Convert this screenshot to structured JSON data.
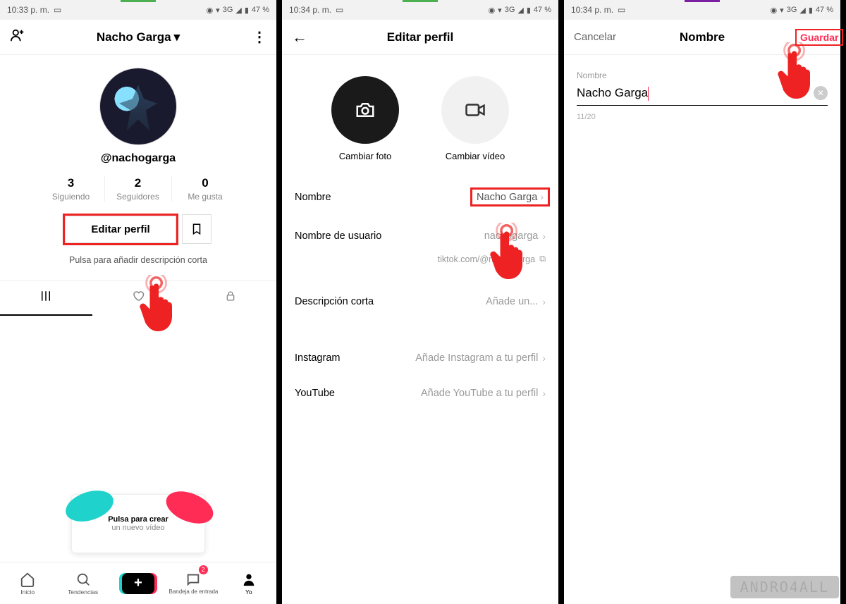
{
  "statusbar": {
    "time_s1": "10:33 p. m.",
    "time_s2": "10:34 p. m.",
    "time_s3": "10:34 p. m.",
    "network": "3G",
    "battery": "47 %"
  },
  "screen1": {
    "title": "Nacho Garga",
    "username": "@nachogarga",
    "stats": [
      {
        "num": "3",
        "lbl": "Siguiendo"
      },
      {
        "num": "2",
        "lbl": "Seguidores"
      },
      {
        "num": "0",
        "lbl": "Me gusta"
      }
    ],
    "edit_button": "Editar perfil",
    "bio_hint": "Pulsa para añadir descripción corta",
    "create_line1": "Pulsa para crear",
    "create_line2": "un nuevo vídeo",
    "nav": {
      "home": "Inicio",
      "trends": "Tendencias",
      "inbox": "Bandeja de entrada",
      "inbox_badge": "2",
      "me": "Yo"
    }
  },
  "screen2": {
    "title": "Editar perfil",
    "change_photo": "Cambiar foto",
    "change_video": "Cambiar vídeo",
    "fields": {
      "name_label": "Nombre",
      "name_value": "Nacho Garga",
      "username_label": "Nombre de usuario",
      "username_value": "nachogarga",
      "profile_url": "tiktok.com/@nachogarga",
      "bio_label": "Descripción corta",
      "bio_value": "Añade un...",
      "instagram_label": "Instagram",
      "instagram_value": "Añade Instagram a tu perfil",
      "youtube_label": "YouTube",
      "youtube_value": "Añade YouTube a tu perfil"
    }
  },
  "screen3": {
    "cancel": "Cancelar",
    "title": "Nombre",
    "save": "Guardar",
    "field_label": "Nombre",
    "input_value": "Nacho Garga",
    "counter": "11/20"
  },
  "watermark": "ANDRO4ALL"
}
